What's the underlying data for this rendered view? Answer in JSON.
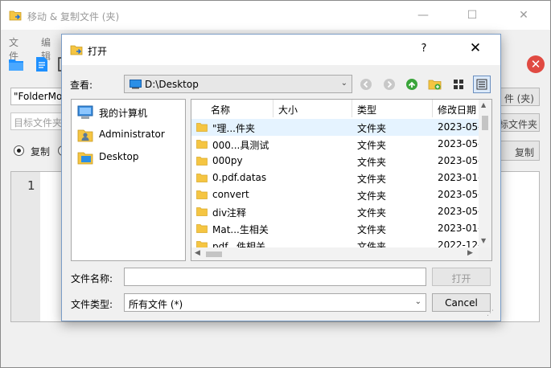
{
  "main_window": {
    "title": "移动 & 复制文件 (夹)",
    "menu": [
      "文件",
      "编辑"
    ],
    "source_value": "\"FolderMo",
    "dest_placeholder": "目标文件夹",
    "btn_source": "件 (夹)",
    "btn_dest": "标文件夹",
    "radio_copy_label": "复制",
    "btn_copy": "复制",
    "line_number": "1",
    "win_minimize": "—",
    "win_maximize": "☐",
    "win_close": "✕",
    "close_badge": "✕"
  },
  "dialog": {
    "title": "打开",
    "help": "?",
    "close": "✕",
    "look_in_label": "查看:",
    "look_in_value": "D:\\Desktop",
    "places": [
      {
        "label": "我的计算机",
        "icon": "computer-icon"
      },
      {
        "label": "Administrator",
        "icon": "user-folder-icon"
      },
      {
        "label": "Desktop",
        "icon": "desktop-folder-icon"
      }
    ],
    "columns": {
      "name": "名称",
      "size": "大小",
      "type": "类型",
      "date": "修改日期"
    },
    "files": [
      {
        "name": "\"理...件夹",
        "type": "文件夹",
        "date": "2023-05-"
      },
      {
        "name": "000...具测试",
        "type": "文件夹",
        "date": "2023-05-"
      },
      {
        "name": "000py",
        "type": "文件夹",
        "date": "2023-05-"
      },
      {
        "name": "0.pdf.datas",
        "type": "文件夹",
        "date": "2023-01-"
      },
      {
        "name": "convert",
        "type": "文件夹",
        "date": "2023-05-"
      },
      {
        "name": "div注释",
        "type": "文件夹",
        "date": "2023-05-"
      },
      {
        "name": "Mat...生相关",
        "type": "文件夹",
        "date": "2023-01-"
      },
      {
        "name": "pdf...件相关",
        "type": "文件夹",
        "date": "2022-12-"
      }
    ],
    "filename_label": "文件名称:",
    "filename_value": "",
    "open_button": "打开",
    "filetype_label": "文件类型:",
    "filetype_value": "所有文件 (*)",
    "cancel_button": "Cancel"
  },
  "colors": {
    "selection": "#e5f3ff",
    "folder": "#f5c542",
    "accent_blue": "#1e90ff",
    "nav_green": "#3aa53a",
    "close_red": "#e04a42"
  }
}
